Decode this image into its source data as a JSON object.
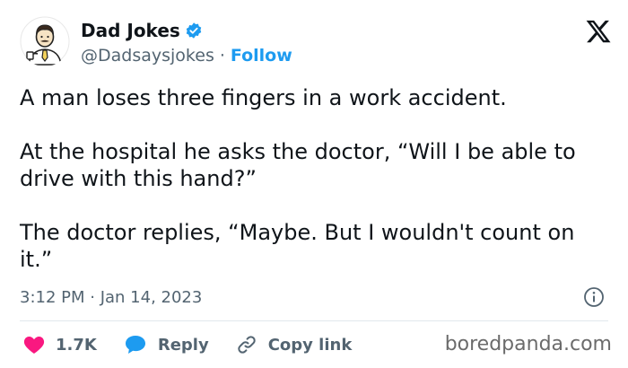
{
  "author": {
    "display_name": "Dad Jokes",
    "handle": "@Dadsaysjokes",
    "separator": "·",
    "follow_label": "Follow",
    "avatar_icon": "cartoon-dad-avatar",
    "verified_icon": "verified-badge-icon",
    "verified_color": "#1d9bf0"
  },
  "platform_icon": "x-logo-icon",
  "tweet": {
    "paragraphs": [
      "A man loses three fingers in a work accident.",
      "At the hospital he asks the doctor, “Will I be able to drive with this hand?”",
      "The doctor replies, “Maybe. But I wouldn't count on it.”"
    ],
    "timestamp": "3:12 PM · Jan 14, 2023"
  },
  "actions": {
    "like_count": "1.7K",
    "reply_label": "Reply",
    "copy_link_label": "Copy link",
    "like_color": "#f91880",
    "reply_color": "#1d9bf0"
  },
  "watermark": "boredpanda.com",
  "colors": {
    "text": "#0f1419",
    "secondary": "#536471",
    "accent": "#1d9bf0"
  }
}
